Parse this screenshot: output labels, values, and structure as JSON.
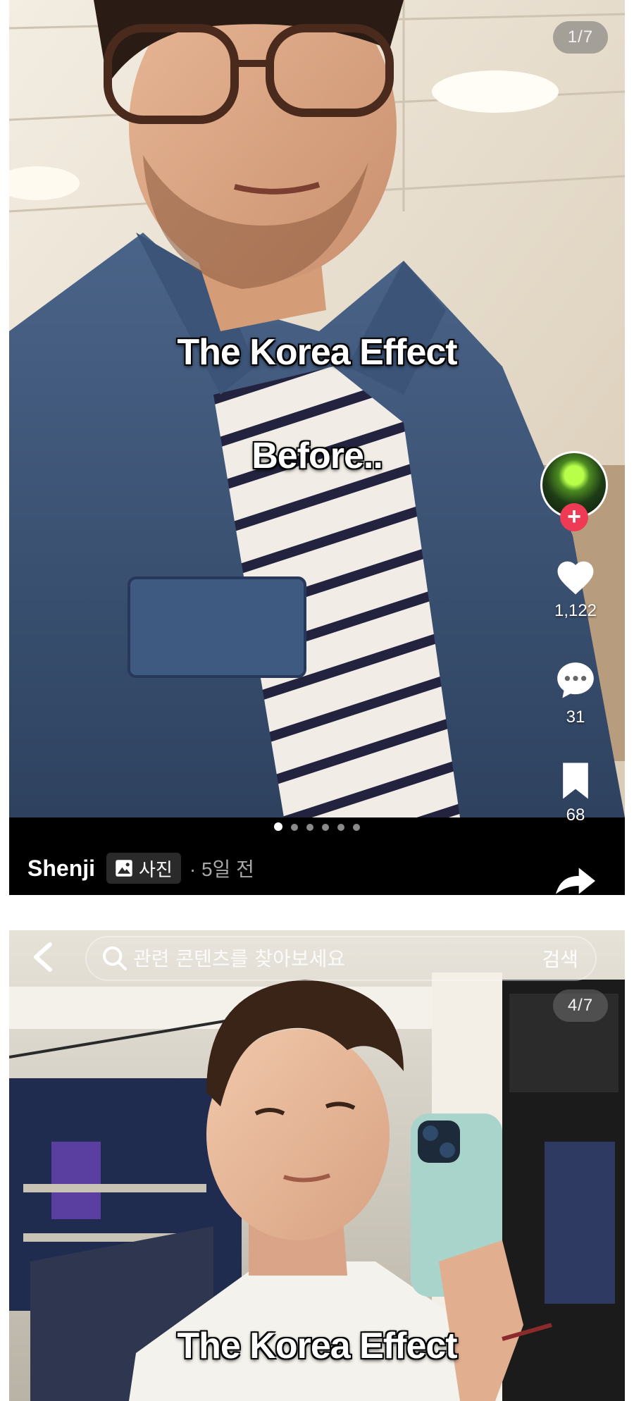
{
  "post1": {
    "page_indicator": "1/7",
    "caption_line1": "The Korea Effect",
    "caption_line2": "Before..",
    "likes": "1,122",
    "comments": "31",
    "saves": "68",
    "carousel": {
      "total": 6,
      "active_index": 0
    },
    "username": "Shenji",
    "photo_tag": "사진",
    "posted_time": "· 5일 전",
    "accent_follow": "#ef3a55"
  },
  "post2": {
    "search_placeholder": "관련 콘텐츠를 찾아보세요",
    "search_button": "검색",
    "page_indicator": "4/7",
    "caption": "The Korea Effect"
  },
  "icons": [
    "back-chevron-icon",
    "search-icon",
    "heart-icon",
    "comment-icon",
    "bookmark-icon",
    "share-icon",
    "photo-icon",
    "plus-icon"
  ]
}
